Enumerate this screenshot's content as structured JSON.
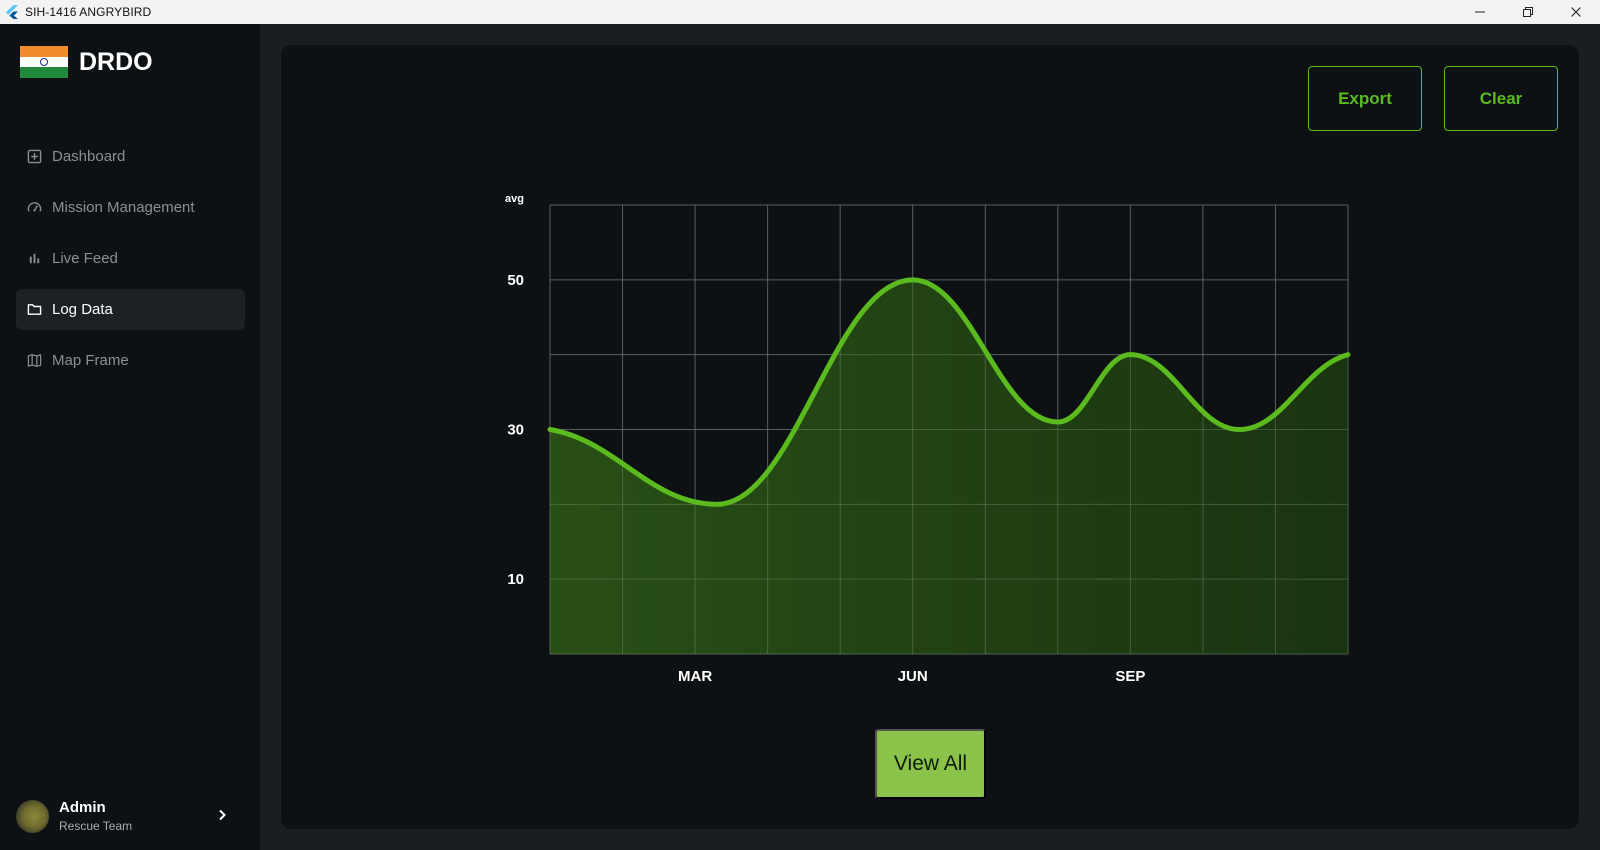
{
  "window": {
    "title": "SIH-1416 ANGRYBIRD"
  },
  "sidebar": {
    "brand": "DRDO",
    "items": [
      {
        "label": "Dashboard",
        "icon": "plus-square-icon",
        "active": false
      },
      {
        "label": "Mission Management",
        "icon": "gauge-icon",
        "active": false
      },
      {
        "label": "Live Feed",
        "icon": "bar-chart-icon",
        "active": false
      },
      {
        "label": "Log Data",
        "icon": "folder-icon",
        "active": true
      },
      {
        "label": "Map Frame",
        "icon": "map-icon",
        "active": false
      }
    ],
    "user": {
      "name": "Admin",
      "role": "Rescue Team"
    }
  },
  "toolbar": {
    "export_label": "Export",
    "clear_label": "Clear"
  },
  "actions": {
    "view_all_label": "View All"
  },
  "colors": {
    "accent": "#5aba1e",
    "button_fill": "#8bc34a",
    "background": "#0d1114"
  },
  "chart_data": {
    "type": "area",
    "ylabel": "avg",
    "y_ticks": [
      "10",
      "30",
      "50"
    ],
    "x_ticks": [
      {
        "x": 2,
        "label": "MAR"
      },
      {
        "x": 5,
        "label": "JUN"
      },
      {
        "x": 8,
        "label": "SEP"
      }
    ],
    "xlim": [
      0,
      11
    ],
    "ylim": [
      0,
      60
    ],
    "grid": true,
    "series": [
      {
        "x": [
          0,
          2.3,
          5,
          7,
          8,
          9.5,
          11
        ],
        "y": [
          30,
          20,
          50,
          31,
          40,
          30,
          40
        ]
      }
    ]
  }
}
